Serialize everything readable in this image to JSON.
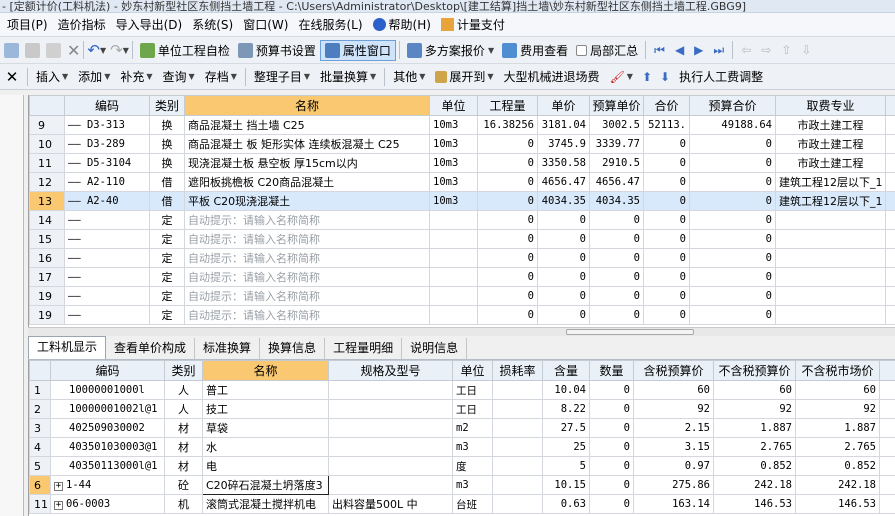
{
  "window": {
    "title": "- [定额计价(工料机法) - 妙东村新型社区东侧挡土墙工程 - C:\\Users\\Administrator\\Desktop\\[建工结算]挡土墙\\妙东村新型社区东侧挡土墙工程.GBG9]"
  },
  "menu": [
    {
      "label": "项目(P)"
    },
    {
      "label": "造价指标"
    },
    {
      "label": "导入导出(D)"
    },
    {
      "label": "系统(S)"
    },
    {
      "label": "窗口(W)"
    },
    {
      "label": "在线服务(L)"
    },
    {
      "label": "帮助(H)"
    },
    {
      "label": "计量支付"
    }
  ],
  "toolbar1": {
    "self_check": "单位工程自检",
    "budget_settings": "预算书设置",
    "property_window": "属性窗口",
    "multi_plan": "多方案报价",
    "fee_view": "费用查看",
    "partial_summary": "局部汇总"
  },
  "toolbar2": {
    "insert": "插入",
    "add": "添加",
    "supplement": "补充",
    "query": "查询",
    "save": "存档",
    "organize": "整理子目",
    "batch_replace": "批量换算",
    "other": "其他",
    "expand_to": "展开到",
    "machinery_fee": "大型机械进退场费",
    "labor_adjust": "执行人工费调整"
  },
  "upper_grid": {
    "headers": [
      "编码",
      "类别",
      "名称",
      "单位",
      "工程量",
      "单价",
      "预算单价",
      "合价",
      "预算合价",
      "取费专业"
    ],
    "rows": [
      {
        "no": "9",
        "code": "D3-313",
        "type": "换",
        "name": "商品混凝土 挡土墙 C25",
        "unit": "10m3",
        "qty": "16.38256",
        "price": "3181.04",
        "budget_price": "3002.5",
        "total": "52113.",
        "budget_total": "49188.64",
        "major": "市政土建工程"
      },
      {
        "no": "10",
        "code": "D3-289",
        "type": "换",
        "name": "商品混凝土 板 矩形实体 连续板混凝土 C25",
        "unit": "10m3",
        "qty": "0",
        "price": "3745.9",
        "budget_price": "3339.77",
        "total": "0",
        "budget_total": "0",
        "major": "市政土建工程"
      },
      {
        "no": "11",
        "code": "D5-3104",
        "type": "换",
        "name": "现浇混凝土板 悬空板 厚15cm以内",
        "unit": "10m3",
        "qty": "0",
        "price": "3350.58",
        "budget_price": "2910.5",
        "total": "0",
        "budget_total": "0",
        "major": "市政土建工程"
      },
      {
        "no": "12",
        "code": "A2-110",
        "type": "借",
        "name": "遮阳板挑檐板 C20商品混凝土",
        "unit": "10m3",
        "qty": "0",
        "price": "4656.47",
        "budget_price": "4656.47",
        "total": "0",
        "budget_total": "0",
        "major": "建筑工程12层以下_1"
      },
      {
        "no": "13",
        "code": "A2-40",
        "type": "借",
        "name": "平板 C20现浇混凝土",
        "unit": "10m3",
        "qty": "0",
        "price": "4034.35",
        "budget_price": "4034.35",
        "total": "0",
        "budget_total": "0",
        "major": "建筑工程12层以下_1"
      },
      {
        "no": "14",
        "code": "",
        "type": "定",
        "name": "自动提示：请输入名称简称",
        "unit": "",
        "qty": "0",
        "price": "0",
        "budget_price": "0",
        "total": "0",
        "budget_total": "0",
        "major": ""
      },
      {
        "no": "15",
        "code": "",
        "type": "定",
        "name": "自动提示：请输入名称简称",
        "unit": "",
        "qty": "0",
        "price": "0",
        "budget_price": "0",
        "total": "0",
        "budget_total": "0",
        "major": ""
      },
      {
        "no": "16",
        "code": "",
        "type": "定",
        "name": "自动提示：请输入名称简称",
        "unit": "",
        "qty": "0",
        "price": "0",
        "budget_price": "0",
        "total": "0",
        "budget_total": "0",
        "major": ""
      },
      {
        "no": "17",
        "code": "",
        "type": "定",
        "name": "自动提示：请输入名称简称",
        "unit": "",
        "qty": "0",
        "price": "0",
        "budget_price": "0",
        "total": "0",
        "budget_total": "0",
        "major": ""
      },
      {
        "no": "19",
        "code": "",
        "type": "定",
        "name": "自动提示：请输入名称简称",
        "unit": "",
        "qty": "0",
        "price": "0",
        "budget_price": "0",
        "total": "0",
        "budget_total": "0",
        "major": ""
      },
      {
        "no": "19",
        "code": "",
        "type": "定",
        "name": "自动提示：请输入名称简称",
        "unit": "",
        "qty": "0",
        "price": "0",
        "budget_price": "0",
        "total": "0",
        "budget_total": "0",
        "major": ""
      }
    ]
  },
  "tabs": [
    {
      "label": "工料机显示"
    },
    {
      "label": "查看单价构成"
    },
    {
      "label": "标准换算"
    },
    {
      "label": "换算信息"
    },
    {
      "label": "工程量明细"
    },
    {
      "label": "说明信息"
    }
  ],
  "lower_grid": {
    "headers": [
      "编码",
      "类别",
      "名称",
      "规格及型号",
      "单位",
      "损耗率",
      "含量",
      "数量",
      "含税预算价",
      "不含税预算价",
      "不含税市场价",
      "含"
    ],
    "rows": [
      {
        "no": "1",
        "code": "10000001000l",
        "type": "人",
        "name": "普工",
        "spec": "",
        "unit": "工日",
        "loss": "",
        "content": "10.04",
        "qty": "0",
        "tax_price": "60",
        "notax_price": "60",
        "market_price": "60"
      },
      {
        "no": "2",
        "code": "10000001002l@1",
        "type": "人",
        "name": "技工",
        "spec": "",
        "unit": "工日",
        "loss": "",
        "content": "8.22",
        "qty": "0",
        "tax_price": "92",
        "notax_price": "92",
        "market_price": "92"
      },
      {
        "no": "3",
        "code": "402509030002",
        "type": "材",
        "name": "草袋",
        "spec": "",
        "unit": "m2",
        "loss": "",
        "content": "27.5",
        "qty": "0",
        "tax_price": "2.15",
        "notax_price": "1.887",
        "market_price": "1.887"
      },
      {
        "no": "4",
        "code": "403501030003@1",
        "type": "材",
        "name": "水",
        "spec": "",
        "unit": "m3",
        "loss": "",
        "content": "25",
        "qty": "0",
        "tax_price": "3.15",
        "notax_price": "2.765",
        "market_price": "2.765"
      },
      {
        "no": "5",
        "code": "40350113000l@1",
        "type": "材",
        "name": "电",
        "spec": "",
        "unit": "度",
        "loss": "",
        "content": "5",
        "qty": "0",
        "tax_price": "0.97",
        "notax_price": "0.852",
        "market_price": "0.852"
      },
      {
        "no": "6",
        "code": "1-44",
        "type": "砼",
        "name": "C20碎石混凝土坍落度3",
        "spec": "",
        "unit": "m3",
        "loss": "",
        "content": "10.15",
        "qty": "0",
        "tax_price": "275.86",
        "notax_price": "242.18",
        "market_price": "242.18",
        "expand": true
      },
      {
        "no": "11",
        "code": "06-0003",
        "type": "机",
        "name": "滚筒式混凝土搅拌机电",
        "spec": "出料容量500L 中",
        "unit": "台班",
        "loss": "",
        "content": "0.63",
        "qty": "0",
        "tax_price": "163.14",
        "notax_price": "146.53",
        "market_price": "146.53",
        "expand": true
      }
    ]
  }
}
